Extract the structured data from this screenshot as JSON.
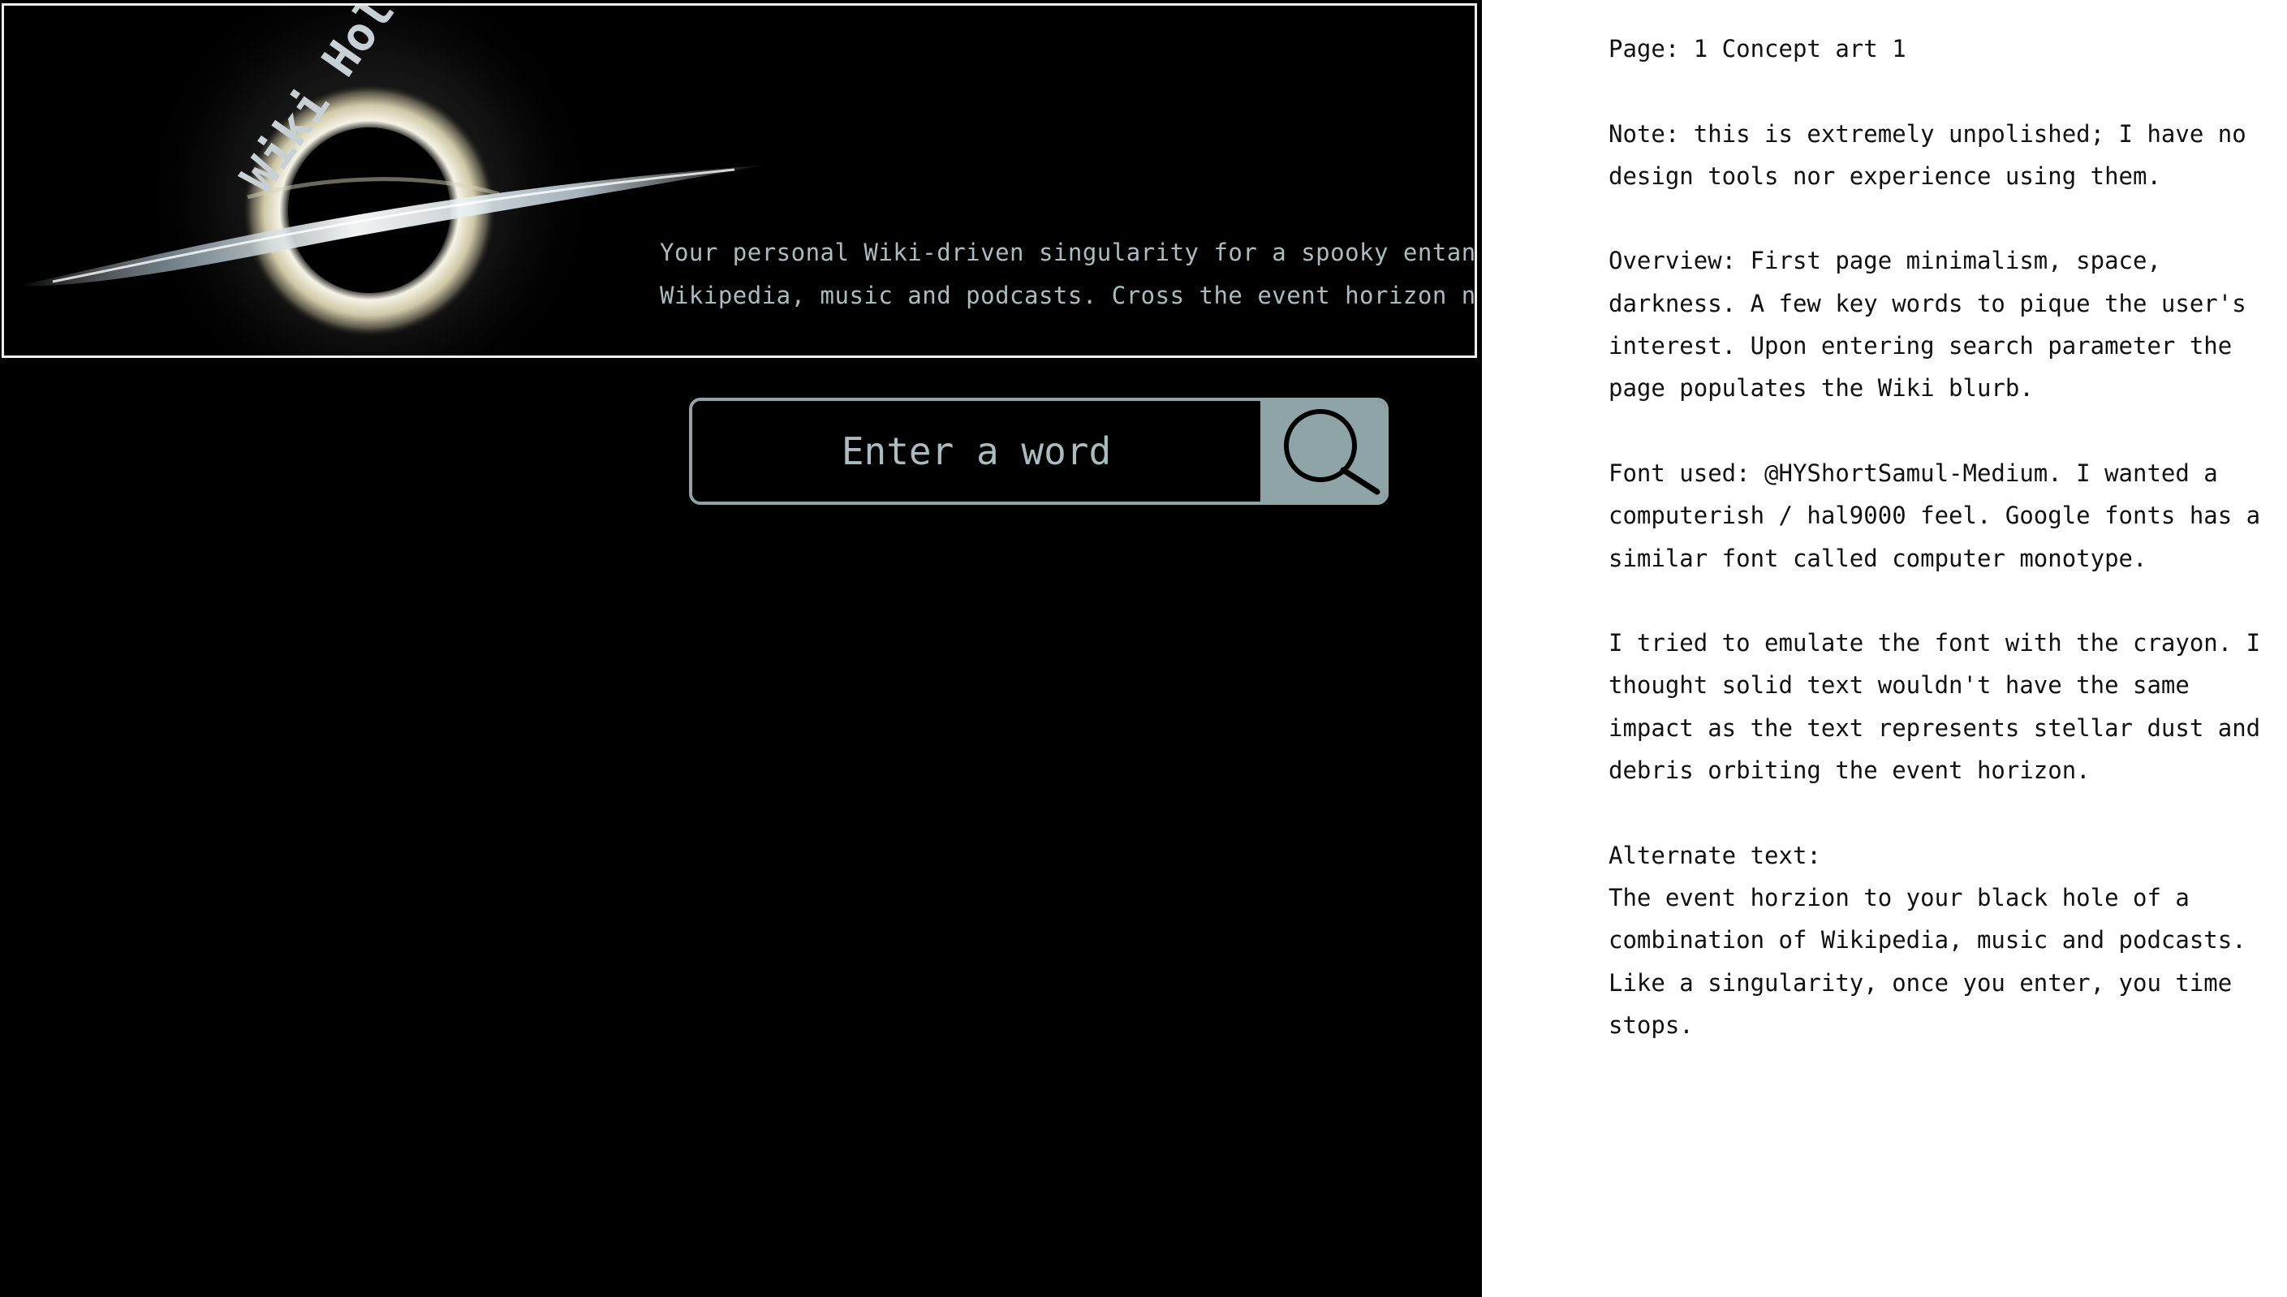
{
  "banner": {
    "logo_text": "Wiki Hole",
    "tagline_lines": [
      "Your personal Wiki-driven singularity for a spooky entanglement of",
      "Wikipedia, music and podcasts. Cross the event horizon now."
    ]
  },
  "search": {
    "placeholder": "Enter a word",
    "button_icon": "search-icon"
  },
  "notes": {
    "page_label": "Page: 1 Concept art 1",
    "note_lines": [
      "Note: this is extremely unpolished; I have no",
      "design tools nor experience using them."
    ],
    "overview_lines": [
      "Overview: First page minimalism, space,",
      "darkness. A few key words to pique the user's",
      "interest. Upon entering search parameter the",
      "page populates the Wiki blurb."
    ],
    "font_lines": [
      "Font used: @HYShortSamul-Medium. I wanted a",
      "computerish / hal9000 feel. Google fonts has a",
      "similar font called computer monotype."
    ],
    "crayon_lines": [
      "I tried to emulate the font with the crayon.  I",
      "thought solid text wouldn't have the same",
      "impact as the text represents stellar dust and",
      "debris orbiting the event horizon."
    ],
    "alternate_heading": "Alternate text:",
    "alternate_lines": [
      "The event horzion to your black hole of a",
      "combination of Wikipedia, music and podcasts.",
      "Like a singularity, once you enter, you time",
      "stops."
    ]
  },
  "colors": {
    "background": "#000000",
    "accent": "#8fa4a6",
    "tagline": "#a9bcc0",
    "notes_text": "#111111"
  }
}
